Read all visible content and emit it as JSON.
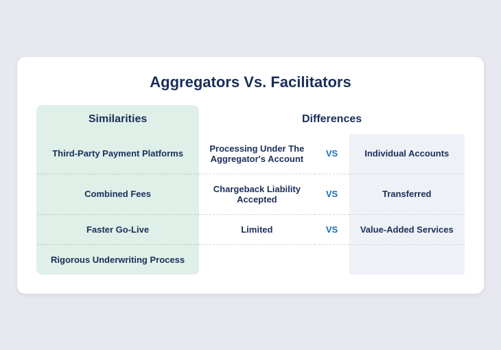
{
  "title": "Aggregators Vs. Facilitators",
  "headers": {
    "similarities": "Similarities",
    "differences": "Differences"
  },
  "rows": [
    {
      "similarity": "Third-Party Payment Platforms",
      "aggregator": "Processing Under The Aggregator's Account",
      "vs": "VS",
      "facilitator": "Individual Accounts"
    },
    {
      "similarity": "Combined Fees",
      "aggregator": "Chargeback Liability Accepted",
      "vs": "VS",
      "facilitator": "Transferred"
    },
    {
      "similarity": "Faster Go-Live",
      "aggregator": "Limited",
      "vs": "VS",
      "facilitator": "Value-Added Services"
    },
    {
      "similarity": "Rigorous Underwriting Process",
      "aggregator": "",
      "vs": "",
      "facilitator": ""
    }
  ]
}
